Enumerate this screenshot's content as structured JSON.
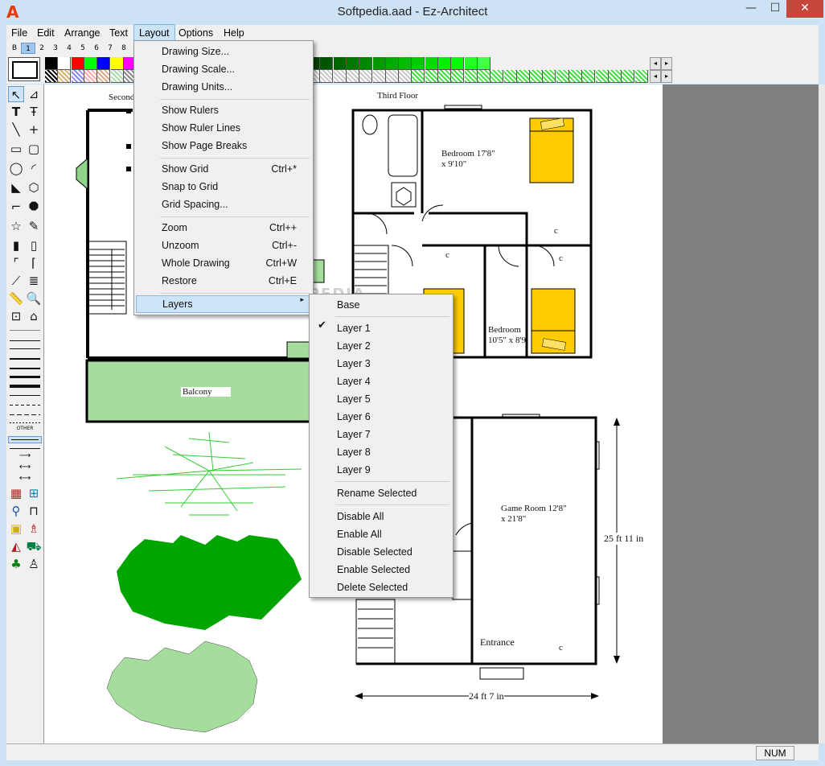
{
  "window": {
    "title": "Softpedia.aad - Ez-Architect",
    "app_icon": "A",
    "minimize": "—",
    "maximize": "☐",
    "close": "✕"
  },
  "menubar": [
    "File",
    "Edit",
    "Arrange",
    "Text",
    "Layout",
    "Options",
    "Help"
  ],
  "toolbar": {
    "layer_tabs": [
      "B",
      "1",
      "2",
      "3",
      "4",
      "5",
      "6",
      "7",
      "8"
    ],
    "colors_row1": [
      "#000000",
      "#ffffff",
      "#ff0000",
      "#00ff00",
      "#0000ff",
      "#ffff00",
      "#ff00ff",
      "#00ffff"
    ],
    "colors_row1_right": [
      "#400000",
      "#600000",
      "#800000",
      "#900000",
      "#a00000",
      "#b00000",
      "#c00000",
      "#d00000",
      "#e00000",
      "#f00000",
      "#ff0000",
      "#003300",
      "#004400",
      "#005500",
      "#006600",
      "#007700",
      "#008800",
      "#009900",
      "#00aa00",
      "#00bb00",
      "#00cc00",
      "#00dd00",
      "#00ee00",
      "#00ff00",
      "#22ff22",
      "#44ff44"
    ],
    "scroll_left": "◂",
    "scroll_right": "▸"
  },
  "layout_menu": {
    "items": [
      {
        "label": "Drawing Size...",
        "shortcut": ""
      },
      {
        "label": "Drawing Scale...",
        "shortcut": ""
      },
      {
        "label": "Drawing Units...",
        "shortcut": ""
      },
      {
        "label": "Show Rulers",
        "shortcut": ""
      },
      {
        "label": "Show Ruler Lines",
        "shortcut": ""
      },
      {
        "label": "Show Page Breaks",
        "shortcut": ""
      },
      {
        "label": "Show Grid",
        "shortcut": "Ctrl+*"
      },
      {
        "label": "Snap to Grid",
        "shortcut": ""
      },
      {
        "label": "Grid Spacing...",
        "shortcut": ""
      },
      {
        "label": "Zoom",
        "shortcut": "Ctrl++"
      },
      {
        "label": "Unzoom",
        "shortcut": "Ctrl+-"
      },
      {
        "label": "Whole Drawing",
        "shortcut": "Ctrl+W"
      },
      {
        "label": "Restore",
        "shortcut": "Ctrl+E"
      },
      {
        "label": "Layers",
        "shortcut": ""
      }
    ],
    "submenu_arrow": "▸"
  },
  "layers_menu": {
    "items": [
      "Base",
      "Layer 1",
      "Layer 2",
      "Layer 3",
      "Layer 4",
      "Layer 5",
      "Layer 6",
      "Layer 7",
      "Layer 8",
      "Layer 9",
      "Rename Selected",
      "Disable All",
      "Enable All",
      "Disable Selected",
      "Enable Selected",
      "Delete Selected"
    ],
    "checked": "Layer 1",
    "check_mark": "✔"
  },
  "drawing": {
    "label_second": "Second",
    "label_third": "Third Floor",
    "bedroom1": "Bedroom 17'8\"",
    "bedroom1_dim": "x 9'10\"",
    "bedroom2": "Bedroom",
    "bedroom2_dim": "10'5\" x 8'9",
    "closet": "c",
    "balcony": "Balcony",
    "game_room": "Game Room 12'8\"",
    "game_room_dim": "x 21'8\"",
    "entrance": "Entrance",
    "dim_vertical": "25 ft 11 in",
    "dim_horizontal": "24 ft 7 in",
    "watermark": "SOFTPEDIA"
  },
  "status": {
    "num": "NUM"
  }
}
